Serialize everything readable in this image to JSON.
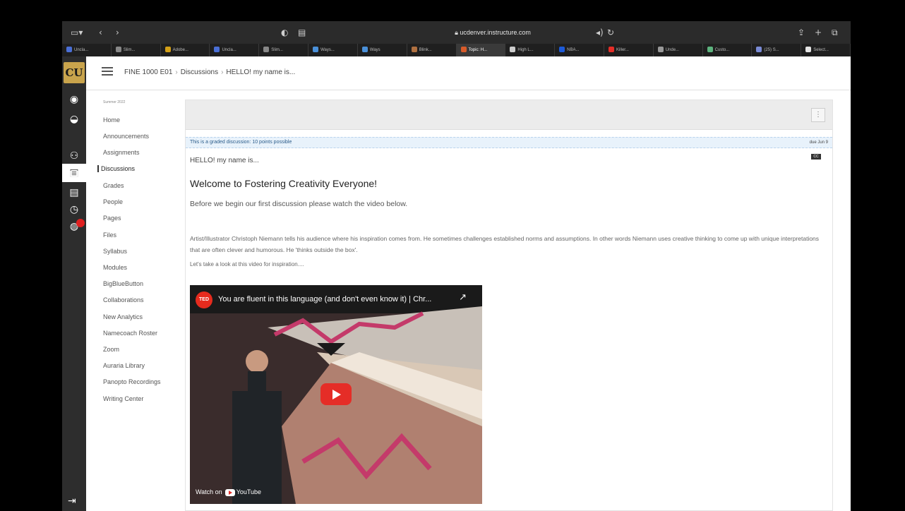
{
  "browser": {
    "url": "ucdenver.instructure.com",
    "tabs": [
      {
        "label": "Uncla..."
      },
      {
        "label": "Slim..."
      },
      {
        "label": "Adobe..."
      },
      {
        "label": "Uncla..."
      },
      {
        "label": "Slim..."
      },
      {
        "label": "Ways..."
      },
      {
        "label": "Ways"
      },
      {
        "label": "Blink..."
      },
      {
        "label": "Topic: H..."
      },
      {
        "label": "High L..."
      },
      {
        "label": "NBA..."
      },
      {
        "label": "Killer..."
      },
      {
        "label": "Unde..."
      },
      {
        "label": "Custo..."
      },
      {
        "label": "(25) S..."
      },
      {
        "label": "Select..."
      }
    ]
  },
  "header": {
    "crumb_course": "FINE 1000 E01",
    "crumb_section": "Discussions",
    "crumb_topic": "HELLO! my name is..."
  },
  "coursenav": {
    "term": "Summer 2022",
    "items": [
      {
        "label": "Home"
      },
      {
        "label": "Announcements"
      },
      {
        "label": "Assignments"
      },
      {
        "label": "Discussions"
      },
      {
        "label": "Grades"
      },
      {
        "label": "People"
      },
      {
        "label": "Pages"
      },
      {
        "label": "Files"
      },
      {
        "label": "Syllabus"
      },
      {
        "label": "Modules"
      },
      {
        "label": "BigBlueButton"
      },
      {
        "label": "Collaborations"
      },
      {
        "label": "New Analytics"
      },
      {
        "label": "Namecoach Roster"
      },
      {
        "label": "Zoom"
      },
      {
        "label": "Auraria Library"
      },
      {
        "label": "Panopto Recordings"
      },
      {
        "label": "Writing Center"
      }
    ]
  },
  "discussion": {
    "graded_notice": "This is a graded discussion: 10 points possible",
    "due_date": "due Jun 9",
    "topic_title": "HELLO! my name is...",
    "heading": "Welcome to Fostering Creativity Everyone!",
    "intro": "Before we begin our first discussion please watch the video below.",
    "body": "Artist/Illustrator Christoph Niemann tells his audience where his inspiration comes from. He sometimes challenges established norms and assumptions. In other words Niemann uses creative thinking to come up with unique interpretations that are often clever and humorous. He 'thinks outside the box'.",
    "prompt": "Let's take a look at this video for inspiration....",
    "cc_label": "CC"
  },
  "video": {
    "logo": "TED",
    "title": "You are fluent in this language (and don't even know it) | Chr...",
    "watch_on": "Watch on",
    "watch_brand": "YouTube"
  },
  "colors": {
    "global_nav": "#2d2d2d",
    "accent_link": "#2b5c8a",
    "youtube_red": "#e52d27",
    "ted_red": "#e62b1e"
  }
}
